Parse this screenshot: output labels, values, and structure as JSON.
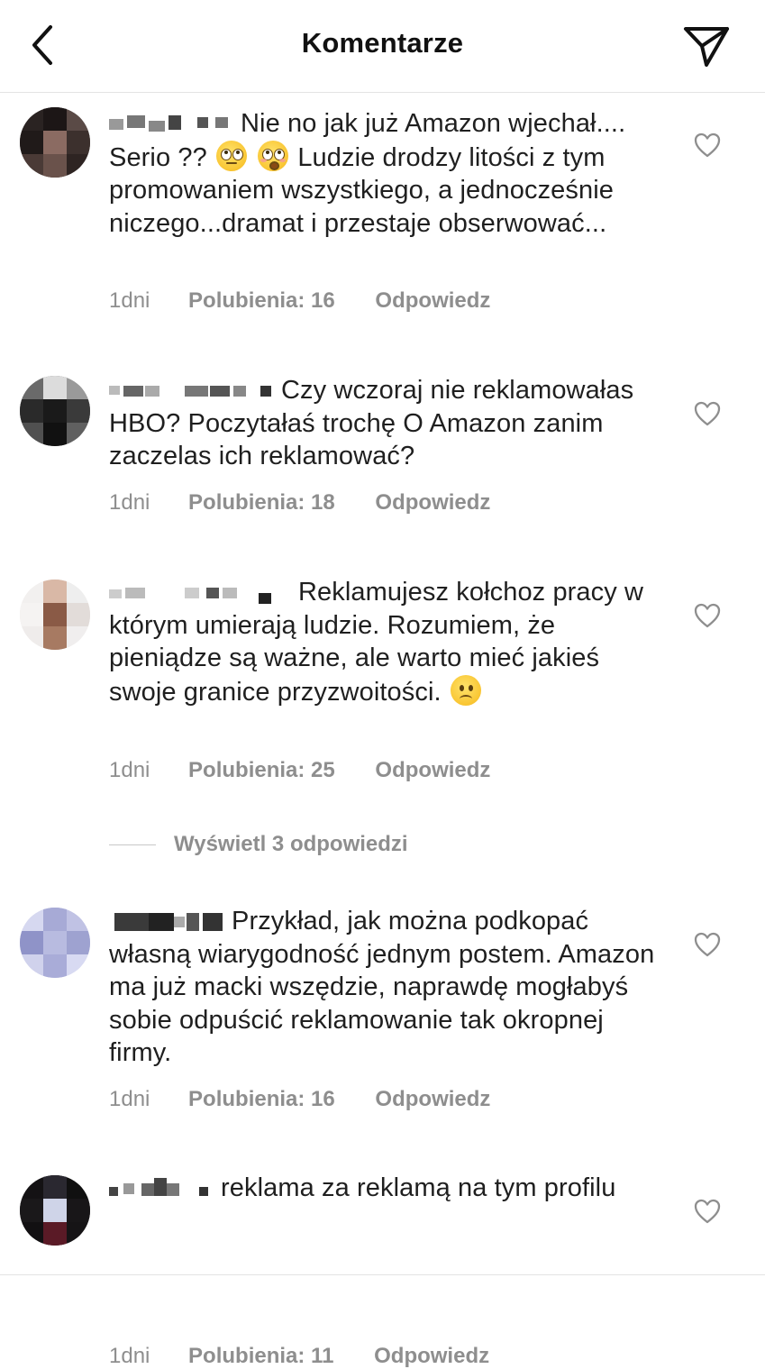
{
  "header": {
    "title": "Komentarze",
    "back_icon": "chevron-left-icon",
    "send_icon": "paper-plane-icon"
  },
  "comments": [
    {
      "text_parts": [
        "Nie no jak już Amazon wjechał.... Serio ?? ",
        " ",
        " Ludzie drodzy litości z tym promowaniem wszystkiego, a jednocześnie niczego...dramat i przestaje obserwować..."
      ],
      "emojis": [
        "face-with-rolling-eyes-icon",
        "flushed-face-icon"
      ],
      "time": "1dni",
      "likes": "Polubienia: 16",
      "reply": "Odpowiedz"
    },
    {
      "text_parts": [
        "Czy wczoraj nie reklamowałas HBO? Poczytałaś trochę O Amazon zanim zaczelas ich reklamować?"
      ],
      "time": "1dni",
      "likes": "Polubienia: 18",
      "reply": "Odpowiedz"
    },
    {
      "text_parts": [
        "Reklamujesz kołchoz pracy w którym umierają ludzie. Rozumiem, że pieniądze są ważne, ale warto mieć jakieś swoje granice przyzwoitości. "
      ],
      "emojis": [
        "confused-face-icon"
      ],
      "time": "1dni",
      "likes": "Polubienia: 25",
      "reply": "Odpowiedz"
    },
    {
      "text_parts": [
        "Przykład, jak można podkopać własną wiarygodność jednym postem. Amazon ma już macki wszędzie, naprawdę mogłabyś sobie odpuścić reklamowanie tak okropnej firmy."
      ],
      "time": "1dni",
      "likes": "Polubienia: 16",
      "reply": "Odpowiedz"
    },
    {
      "text_parts": [
        "reklama za reklamą na tym profilu"
      ],
      "time": "1dni",
      "likes": "Polubienia: 11",
      "reply": "Odpowiedz"
    }
  ],
  "view_replies": "Wyświetl 3 odpowiedzi",
  "icons": {
    "like": "heart-outline-icon"
  },
  "colors": {
    "text": "#1f1f1f",
    "meta": "#8e8e8e",
    "divider": "#e3e3e3"
  }
}
